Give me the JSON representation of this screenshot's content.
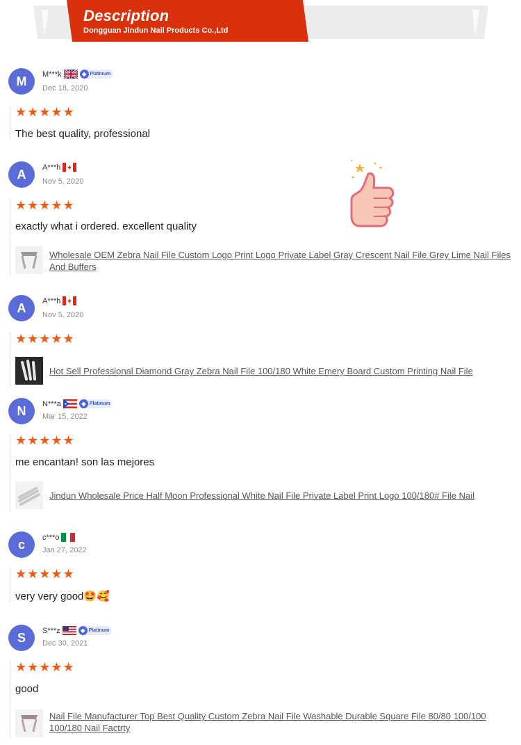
{
  "banner": {
    "title": "Description",
    "subtitle": "Dongguan Jindun Nail Products Co.,Ltd"
  },
  "colors": {
    "accent_red": "#d9310b",
    "star": "#f05a14",
    "avatar": "#5a6bd8"
  },
  "reviews": [
    {
      "initial": "M",
      "name": "M***k",
      "flag": "uk-flag-icon",
      "badge": "Platinum",
      "date": "Dec 18, 2020",
      "stars": "★★★★★",
      "text": "The best quality, professional",
      "product": ""
    },
    {
      "initial": "A",
      "name": "A***h",
      "flag": "canada-flag-icon",
      "badge": "",
      "date": "Nov 5, 2020",
      "stars": "★★★★★",
      "text": "exactly what i ordered. excellent quality",
      "product": "Wholesale OEM Zebra Nail File Custom Logo Print Logo Private Label Gray Crescent Nail File Grey Lime Nail Files And Buffers"
    },
    {
      "initial": "A",
      "name": "A***h",
      "flag": "canada-flag-icon",
      "badge": "",
      "date": "Nov 5, 2020",
      "stars": "★★★★★",
      "text": "",
      "product": "Hot Sell Professional Diamond Gray Zebra Nail File 100/180 White Emery Board Custom Printing Nail File"
    },
    {
      "initial": "N",
      "name": "N***a",
      "flag": "puerto-rico-flag-icon",
      "badge": "Platinum",
      "date": "Mar 15, 2022",
      "stars": "★★★★★",
      "text": "me encantan! son las mejores",
      "product": "Jindun Wholesale Price Half Moon Professional White Nail File Private Label Print Logo 100/180# File Nail"
    },
    {
      "initial": "c",
      "name": "c***o",
      "flag": "italy-flag-icon",
      "badge": "",
      "date": "Jan 27, 2022",
      "stars": "★★★★★",
      "text": "very very good🤩🥰",
      "product": ""
    },
    {
      "initial": "S",
      "name": "S***z",
      "flag": "usa-flag-icon",
      "badge": "Platinum",
      "date": "Dec 30, 2021",
      "stars": "★★★★★",
      "text": "good",
      "product": "Nail File Manufacturer Top Best Quality Custom Zebra Nail File Washable Durable Square File 80/80 100/100 100/180 Nail Factrty"
    }
  ]
}
